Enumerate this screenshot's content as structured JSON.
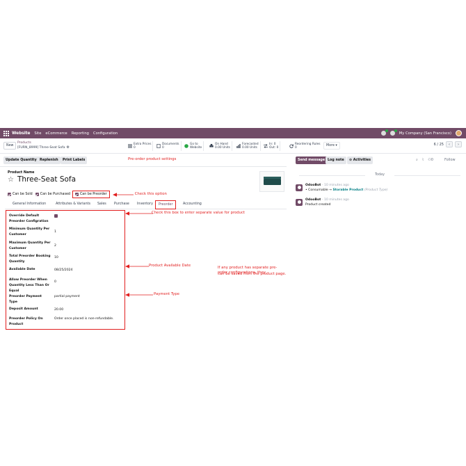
{
  "navbar": {
    "app_name": "Website",
    "menu": [
      "Site",
      "eCommerce",
      "Reporting",
      "Configuration"
    ],
    "company": "My Company (San Francisco)",
    "bg_color": "#714B67"
  },
  "control_panel": {
    "new_label": "New",
    "breadcrumb_parent": "Products",
    "breadcrumb_current": "[FURN_8999] Three-Seat Sofa",
    "smart_buttons": [
      {
        "icon": "list-icon",
        "line1": "Extra Prices",
        "line2": "0"
      },
      {
        "icon": "file-icon",
        "line1": "Documents",
        "line2": "0"
      },
      {
        "icon": "globe-icon",
        "line1": "Go to",
        "line2": "Website"
      },
      {
        "icon": "cubes-icon",
        "line1": "On Hand",
        "line2": "0.00 Units"
      },
      {
        "icon": "chart-icon",
        "line1": "Forecasted",
        "line2": "0.00 Units"
      },
      {
        "icon": "exchange-icon",
        "line1": "In: 0",
        "line2": "Out: 0"
      },
      {
        "icon": "refresh-icon",
        "line1": "Reordering Rules",
        "line2": "0"
      }
    ],
    "more_label": "More ▾",
    "pager": "6 / 25"
  },
  "action_bar": {
    "buttons": [
      "Update Quantity",
      "Replenish",
      "Print Labels"
    ]
  },
  "annotations": {
    "settings": "Pre-order product settings",
    "check_option": "Check this option",
    "check_box": "Check this box to enter separate value for product",
    "available_date": "Product Available Date",
    "payment_type": "Payment Type",
    "note_line1": "If any product has separate pre-order configurations, they",
    "note_line2": "can be saved from the product page."
  },
  "product": {
    "name_label": "Product Name",
    "name": "Three-Seat Sofa",
    "checkboxes": [
      "Can be Sold",
      "Can be Purchased",
      "Can be Preorder"
    ]
  },
  "tabs": [
    "General Information",
    "Attributes & Variants",
    "Sales",
    "Purchase",
    "Inventory",
    "Preorder",
    "Accounting"
  ],
  "preorder_fields": [
    {
      "label": "Override Default Preorder Configration",
      "value": ""
    },
    {
      "label": "Minimum Quantity Per Customer",
      "value": "1"
    },
    {
      "label": "Maximum Quantity Per Customer",
      "value": "2"
    },
    {
      "label": "Total Preorder Booking Quantity",
      "value": "10"
    },
    {
      "label": "Available Date",
      "value": "08/25/2024"
    },
    {
      "label": "Allow Preorder When Quantity Less Than Or Equal",
      "value": "0"
    },
    {
      "label": "Preorder Payment Type",
      "value": "partial payment"
    },
    {
      "label": "Deposit Amount",
      "value": "20.00"
    },
    {
      "label": "Preorder Policy On Product",
      "value": "Order once placed is non-refundable."
    }
  ],
  "chatter": {
    "send_message": "Send message",
    "log_note": "Log note",
    "activities": "Activities",
    "followers_count": "0",
    "follow": "Follow",
    "today": "Today",
    "messages": [
      {
        "author": "OdooBot",
        "time": "- 10 minutes ago",
        "from": "Consumable",
        "to": "Storable Product",
        "field": "(Product Type)"
      },
      {
        "author": "OdooBot",
        "time": "- 10 minutes ago",
        "text": "Product created"
      }
    ]
  }
}
